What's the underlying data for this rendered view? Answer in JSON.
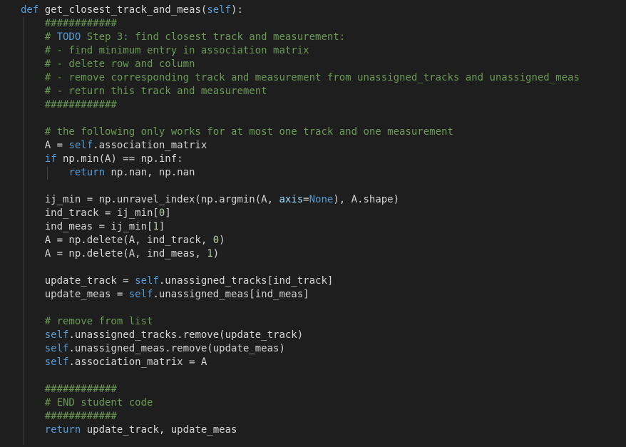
{
  "editor": {
    "background": "#1e1e1e",
    "lines": [
      [
        {
          "t": "def",
          "c": "kw"
        },
        {
          "t": " ",
          "c": "plain"
        },
        {
          "t": "get_closest_track_and_meas",
          "c": "plain"
        },
        {
          "t": "(",
          "c": "plain"
        },
        {
          "t": "self",
          "c": "self"
        },
        {
          "t": "):",
          "c": "plain"
        }
      ],
      [
        {
          "t": "    ",
          "c": "plain"
        },
        {
          "t": "############",
          "c": "cmt"
        }
      ],
      [
        {
          "t": "    ",
          "c": "plain"
        },
        {
          "t": "# ",
          "c": "cmt"
        },
        {
          "t": "TODO",
          "c": "todo"
        },
        {
          "t": " Step 3: find closest track and measurement:",
          "c": "cmt"
        }
      ],
      [
        {
          "t": "    ",
          "c": "plain"
        },
        {
          "t": "# - find minimum entry in association matrix",
          "c": "cmt"
        }
      ],
      [
        {
          "t": "    ",
          "c": "plain"
        },
        {
          "t": "# - delete row and column",
          "c": "cmt"
        }
      ],
      [
        {
          "t": "    ",
          "c": "plain"
        },
        {
          "t": "# - remove corresponding track and measurement from unassigned_tracks and unassigned_meas",
          "c": "cmt"
        }
      ],
      [
        {
          "t": "    ",
          "c": "plain"
        },
        {
          "t": "# - return this track and measurement",
          "c": "cmt"
        }
      ],
      [
        {
          "t": "    ",
          "c": "plain"
        },
        {
          "t": "############",
          "c": "cmt"
        }
      ],
      [],
      [
        {
          "t": "    ",
          "c": "plain"
        },
        {
          "t": "# the following only works for at most one track and one measurement",
          "c": "cmt"
        }
      ],
      [
        {
          "t": "    A = ",
          "c": "plain"
        },
        {
          "t": "self",
          "c": "self"
        },
        {
          "t": ".association_matrix",
          "c": "plain"
        }
      ],
      [
        {
          "t": "    ",
          "c": "plain"
        },
        {
          "t": "if",
          "c": "kw"
        },
        {
          "t": " np.min(A) == np.inf:",
          "c": "plain"
        }
      ],
      [
        {
          "t": "        ",
          "c": "plain"
        },
        {
          "t": "return",
          "c": "kw"
        },
        {
          "t": " np.nan, np.nan",
          "c": "plain"
        }
      ],
      [],
      [
        {
          "t": "    ij_min = np.unravel_index(np.argmin(A, ",
          "c": "plain"
        },
        {
          "t": "axis",
          "c": "param"
        },
        {
          "t": "=",
          "c": "plain"
        },
        {
          "t": "None",
          "c": "kw"
        },
        {
          "t": "), A.shape)",
          "c": "plain"
        }
      ],
      [
        {
          "t": "    ind_track = ij_min[",
          "c": "plain"
        },
        {
          "t": "0",
          "c": "num"
        },
        {
          "t": "]",
          "c": "plain"
        }
      ],
      [
        {
          "t": "    ind_meas = ij_min[",
          "c": "plain"
        },
        {
          "t": "1",
          "c": "num"
        },
        {
          "t": "]",
          "c": "plain"
        }
      ],
      [
        {
          "t": "    A = np.delete(A, ind_track, ",
          "c": "plain"
        },
        {
          "t": "0",
          "c": "num"
        },
        {
          "t": ")",
          "c": "plain"
        }
      ],
      [
        {
          "t": "    A = np.delete(A, ind_meas, ",
          "c": "plain"
        },
        {
          "t": "1",
          "c": "num"
        },
        {
          "t": ")",
          "c": "plain"
        }
      ],
      [],
      [
        {
          "t": "    update_track = ",
          "c": "plain"
        },
        {
          "t": "self",
          "c": "self"
        },
        {
          "t": ".unassigned_tracks[ind_track]",
          "c": "plain"
        }
      ],
      [
        {
          "t": "    update_meas = ",
          "c": "plain"
        },
        {
          "t": "self",
          "c": "self"
        },
        {
          "t": ".unassigned_meas[ind_meas]",
          "c": "plain"
        }
      ],
      [],
      [
        {
          "t": "    ",
          "c": "plain"
        },
        {
          "t": "# remove from list",
          "c": "cmt"
        }
      ],
      [
        {
          "t": "    ",
          "c": "plain"
        },
        {
          "t": "self",
          "c": "self"
        },
        {
          "t": ".unassigned_tracks.remove(update_track)",
          "c": "plain"
        }
      ],
      [
        {
          "t": "    ",
          "c": "plain"
        },
        {
          "t": "self",
          "c": "self"
        },
        {
          "t": ".unassigned_meas.remove(update_meas)",
          "c": "plain"
        }
      ],
      [
        {
          "t": "    ",
          "c": "plain"
        },
        {
          "t": "self",
          "c": "self"
        },
        {
          "t": ".association_matrix = A",
          "c": "plain"
        }
      ],
      [],
      [
        {
          "t": "    ",
          "c": "plain"
        },
        {
          "t": "############",
          "c": "cmt"
        }
      ],
      [
        {
          "t": "    ",
          "c": "plain"
        },
        {
          "t": "# END student code",
          "c": "cmt"
        }
      ],
      [
        {
          "t": "    ",
          "c": "plain"
        },
        {
          "t": "############",
          "c": "cmt"
        }
      ],
      [
        {
          "t": "    ",
          "c": "plain"
        },
        {
          "t": "return",
          "c": "kw"
        },
        {
          "t": " update_track, update_meas",
          "c": "plain"
        }
      ]
    ]
  }
}
